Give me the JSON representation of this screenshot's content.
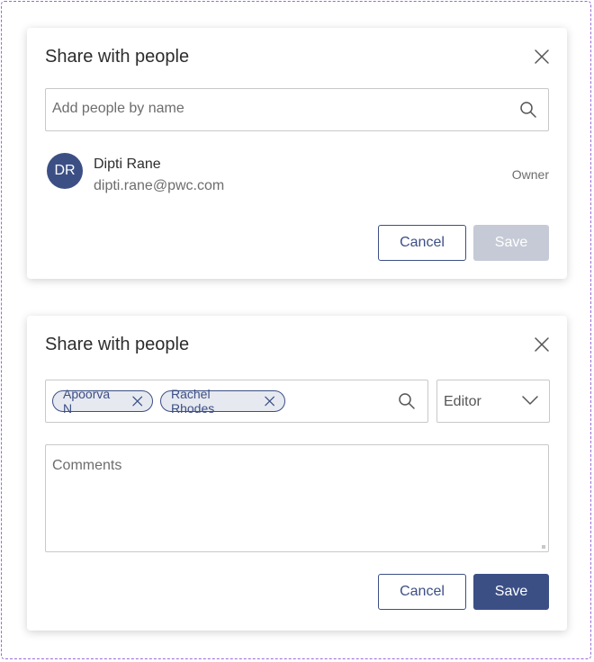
{
  "share_dialog_empty": {
    "title": "Share with people",
    "search": {
      "placeholder": "Add people by name",
      "value": ""
    },
    "owner": {
      "initials": "DR",
      "name": "Dipti Rane",
      "email": "dipti.rane@pwc.com",
      "role": "Owner"
    },
    "buttons": {
      "cancel": "Cancel",
      "save": "Save"
    }
  },
  "share_dialog_filled": {
    "title": "Share with people",
    "chips": [
      "Apoorva N",
      "Rachel Rhodes"
    ],
    "role_select": {
      "selected": "Editor"
    },
    "comments": {
      "placeholder": "Comments",
      "value": ""
    },
    "buttons": {
      "cancel": "Cancel",
      "save": "Save"
    }
  },
  "icons": {
    "close": "close-icon",
    "search": "search-icon",
    "chip_remove": "close-icon",
    "dropdown": "chevron-down-icon"
  },
  "colors": {
    "primary": "#3c4f85",
    "disabled": "#c5cad6",
    "border": "#c8c8c8",
    "chip_bg": "#e6e9f0",
    "frame_dash": "#9b6ad6"
  }
}
